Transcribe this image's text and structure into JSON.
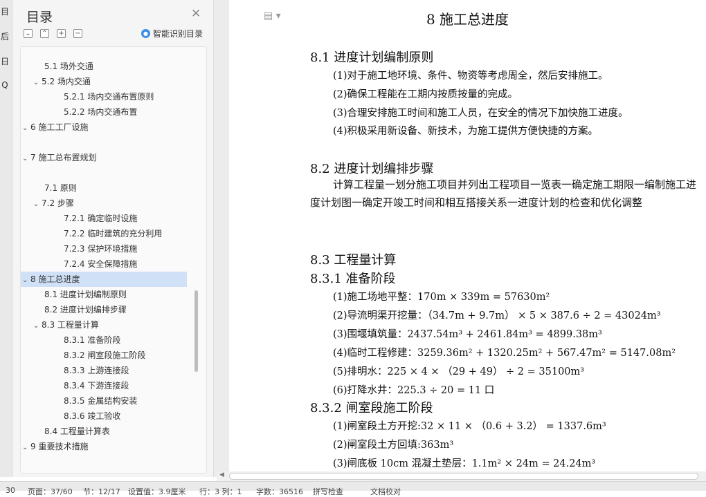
{
  "leftbar": {
    "items": [
      "目",
      "后",
      "日",
      "Q"
    ]
  },
  "toc": {
    "title": "目录",
    "close_icon": "✕",
    "tool_icons": [
      "collapse-all",
      "expand-up",
      "add",
      "remove"
    ],
    "tool_glyphs": [
      "⌄",
      "⌃",
      "+",
      "−"
    ],
    "smart_label": "智能识别目录",
    "items": [
      {
        "label": "5.1 场外交通",
        "level": 2,
        "chev": "",
        "selected": false
      },
      {
        "label": "5.2 场内交通",
        "level": 2,
        "chev": "⌄",
        "selected": false
      },
      {
        "label": "5.2.1 场内交通布置原则",
        "level": 3,
        "chev": "",
        "selected": false
      },
      {
        "label": "5.2.2 场内交通布置",
        "level": 3,
        "chev": "",
        "selected": false
      },
      {
        "label": "6   施工工厂设施",
        "level": 1,
        "chev": "⌄",
        "selected": false
      },
      {
        "label": "7   施工总布置规划",
        "level": 1,
        "chev": "⌄",
        "selected": false
      },
      {
        "label": "7.1 原则",
        "level": 2,
        "chev": "",
        "selected": false
      },
      {
        "label": "7.2 步骤",
        "level": 2,
        "chev": "⌄",
        "selected": false
      },
      {
        "label": "7.2.1 确定临时设施",
        "level": 3,
        "chev": "",
        "selected": false
      },
      {
        "label": "7.2.2 临时建筑的充分利用",
        "level": 3,
        "chev": "",
        "selected": false
      },
      {
        "label": "7.2.3 保护环境措施",
        "level": 3,
        "chev": "",
        "selected": false
      },
      {
        "label": "7.2.4 安全保障措施",
        "level": 3,
        "chev": "",
        "selected": false
      },
      {
        "label": "8   施工总进度",
        "level": 1,
        "chev": "⌄",
        "selected": true
      },
      {
        "label": "8.1 进度计划编制原则",
        "level": 2,
        "chev": "",
        "selected": false
      },
      {
        "label": "8.2 进度计划编排步骤",
        "level": 2,
        "chev": "",
        "selected": false
      },
      {
        "label": "8.3 工程量计算",
        "level": 2,
        "chev": "⌄",
        "selected": false
      },
      {
        "label": "8.3.1 准备阶段",
        "level": 3,
        "chev": "",
        "selected": false
      },
      {
        "label": "8.3.2 闸室段施工阶段",
        "level": 3,
        "chev": "",
        "selected": false
      },
      {
        "label": "8.3.3 上游连接段",
        "level": 3,
        "chev": "",
        "selected": false
      },
      {
        "label": "8.3.4 下游连接段",
        "level": 3,
        "chev": "",
        "selected": false
      },
      {
        "label": "8.3.5 金属结构安装",
        "level": 3,
        "chev": "",
        "selected": false
      },
      {
        "label": "8.3.6 竣工验收",
        "level": 3,
        "chev": "",
        "selected": false
      },
      {
        "label": "8.4 工程量计算表",
        "level": 2,
        "chev": "",
        "selected": false
      },
      {
        "label": "9   重要技术措施",
        "level": 1,
        "chev": "⌄",
        "selected": false
      }
    ]
  },
  "doc": {
    "title": "8    施工总进度",
    "s81": {
      "heading": "8.1 进度计划编制原则",
      "items": [
        "(1)对于施工地环境、条件、物资等考虑周全，然后安排施工。",
        "(2)确保工程能在工期内按质按量的完成。",
        "(3)合理安排施工时间和施工人员，在安全的情况下加快施工进度。",
        "(4)积极采用新设备、新技术，为施工提供方便快捷的方案。"
      ]
    },
    "s82": {
      "heading": "8.2 进度计划编排步骤",
      "paragraph": "计算工程量一划分施工项目并列出工程项目一览表一确定施工期限一编制施工进度计划图一确定开竣工时间和相互搭接关系一进度计划的检查和优化调整"
    },
    "s83": {
      "heading": "8.3 工程量计算"
    },
    "s831": {
      "heading": "8.3.1 准备阶段",
      "items": [
        "(1)施工场地平整：170m × 339m = 57630m²",
        "(2)导流明渠开挖量：（34.7m + 9.7m） × 5 × 387.6 ÷ 2 = 43024m³",
        "(3)围堰填筑量：2437.54m³ + 2461.84m³ = 4899.38m³",
        "(4)临时工程修建：3259.36m² + 1320.25m² + 567.47m² = 5147.08m²",
        "(5)排明水：225 × 4 × （29 + 49） ÷ 2 = 35100m³",
        "(6)打降水井：225.3 ÷ 20 = 11 口"
      ]
    },
    "s832": {
      "heading": "8.3.2 闸室段施工阶段",
      "items": [
        "(1)闸室段土方开挖:32 × 11 × （0.6 + 3.2） = 1337.6m³",
        "(2)闸室段土方回填:363m³",
        "(3)闸底板 10cm 混凝土垫层：1.1m² × 24m = 24.24m³"
      ]
    }
  },
  "status": {
    "items": [
      "30",
      "页面：37/60",
      "节：12/17",
      "设置值：3.9厘米",
      "行：3  列：1",
      "字数：36516",
      "拼写检查",
      "文档校对"
    ]
  }
}
